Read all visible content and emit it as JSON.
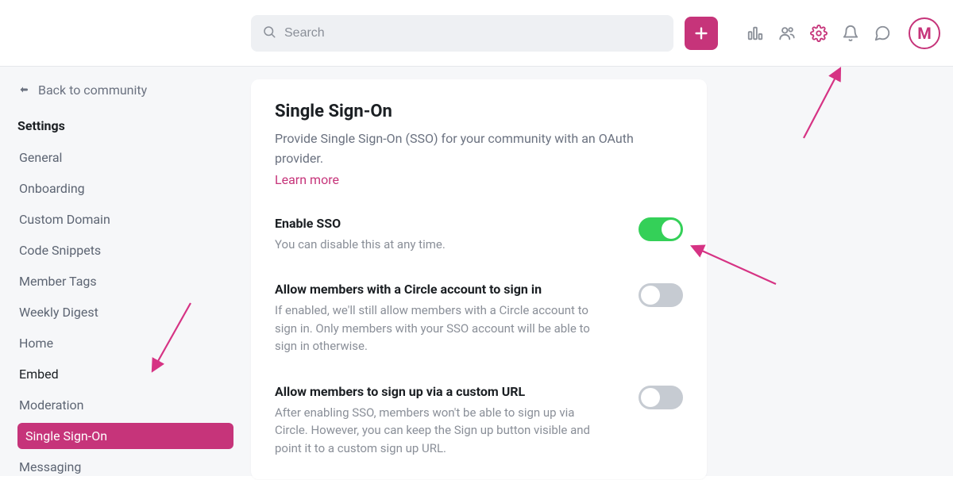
{
  "search": {
    "placeholder": "Search"
  },
  "avatar": "M",
  "sidebar": {
    "back_label": "Back to community",
    "section_title": "Settings",
    "items": [
      {
        "label": "General"
      },
      {
        "label": "Onboarding"
      },
      {
        "label": "Custom Domain"
      },
      {
        "label": "Code Snippets"
      },
      {
        "label": "Member Tags"
      },
      {
        "label": "Weekly Digest"
      },
      {
        "label": "Home"
      },
      {
        "label": "Embed"
      },
      {
        "label": "Moderation"
      },
      {
        "label": "Single Sign-On"
      },
      {
        "label": "Messaging"
      }
    ]
  },
  "main": {
    "title": "Single Sign-On",
    "subtitle": "Provide Single Sign-On (SSO) for your community with an OAuth provider.",
    "learn_more": "Learn more",
    "settings": [
      {
        "label": "Enable SSO",
        "desc": "You can disable this at any time.",
        "on": true
      },
      {
        "label": "Allow members with a Circle account to sign in",
        "desc": "If enabled, we'll still allow members with a Circle account to sign in. Only members with your SSO account will be able to sign in otherwise.",
        "on": false
      },
      {
        "label": "Allow members to sign up via a custom URL",
        "desc": "After enabling SSO, members won't be able to sign up via Circle. However, you can keep the Sign up button visible and point it to a custom sign up URL.",
        "on": false
      }
    ]
  }
}
